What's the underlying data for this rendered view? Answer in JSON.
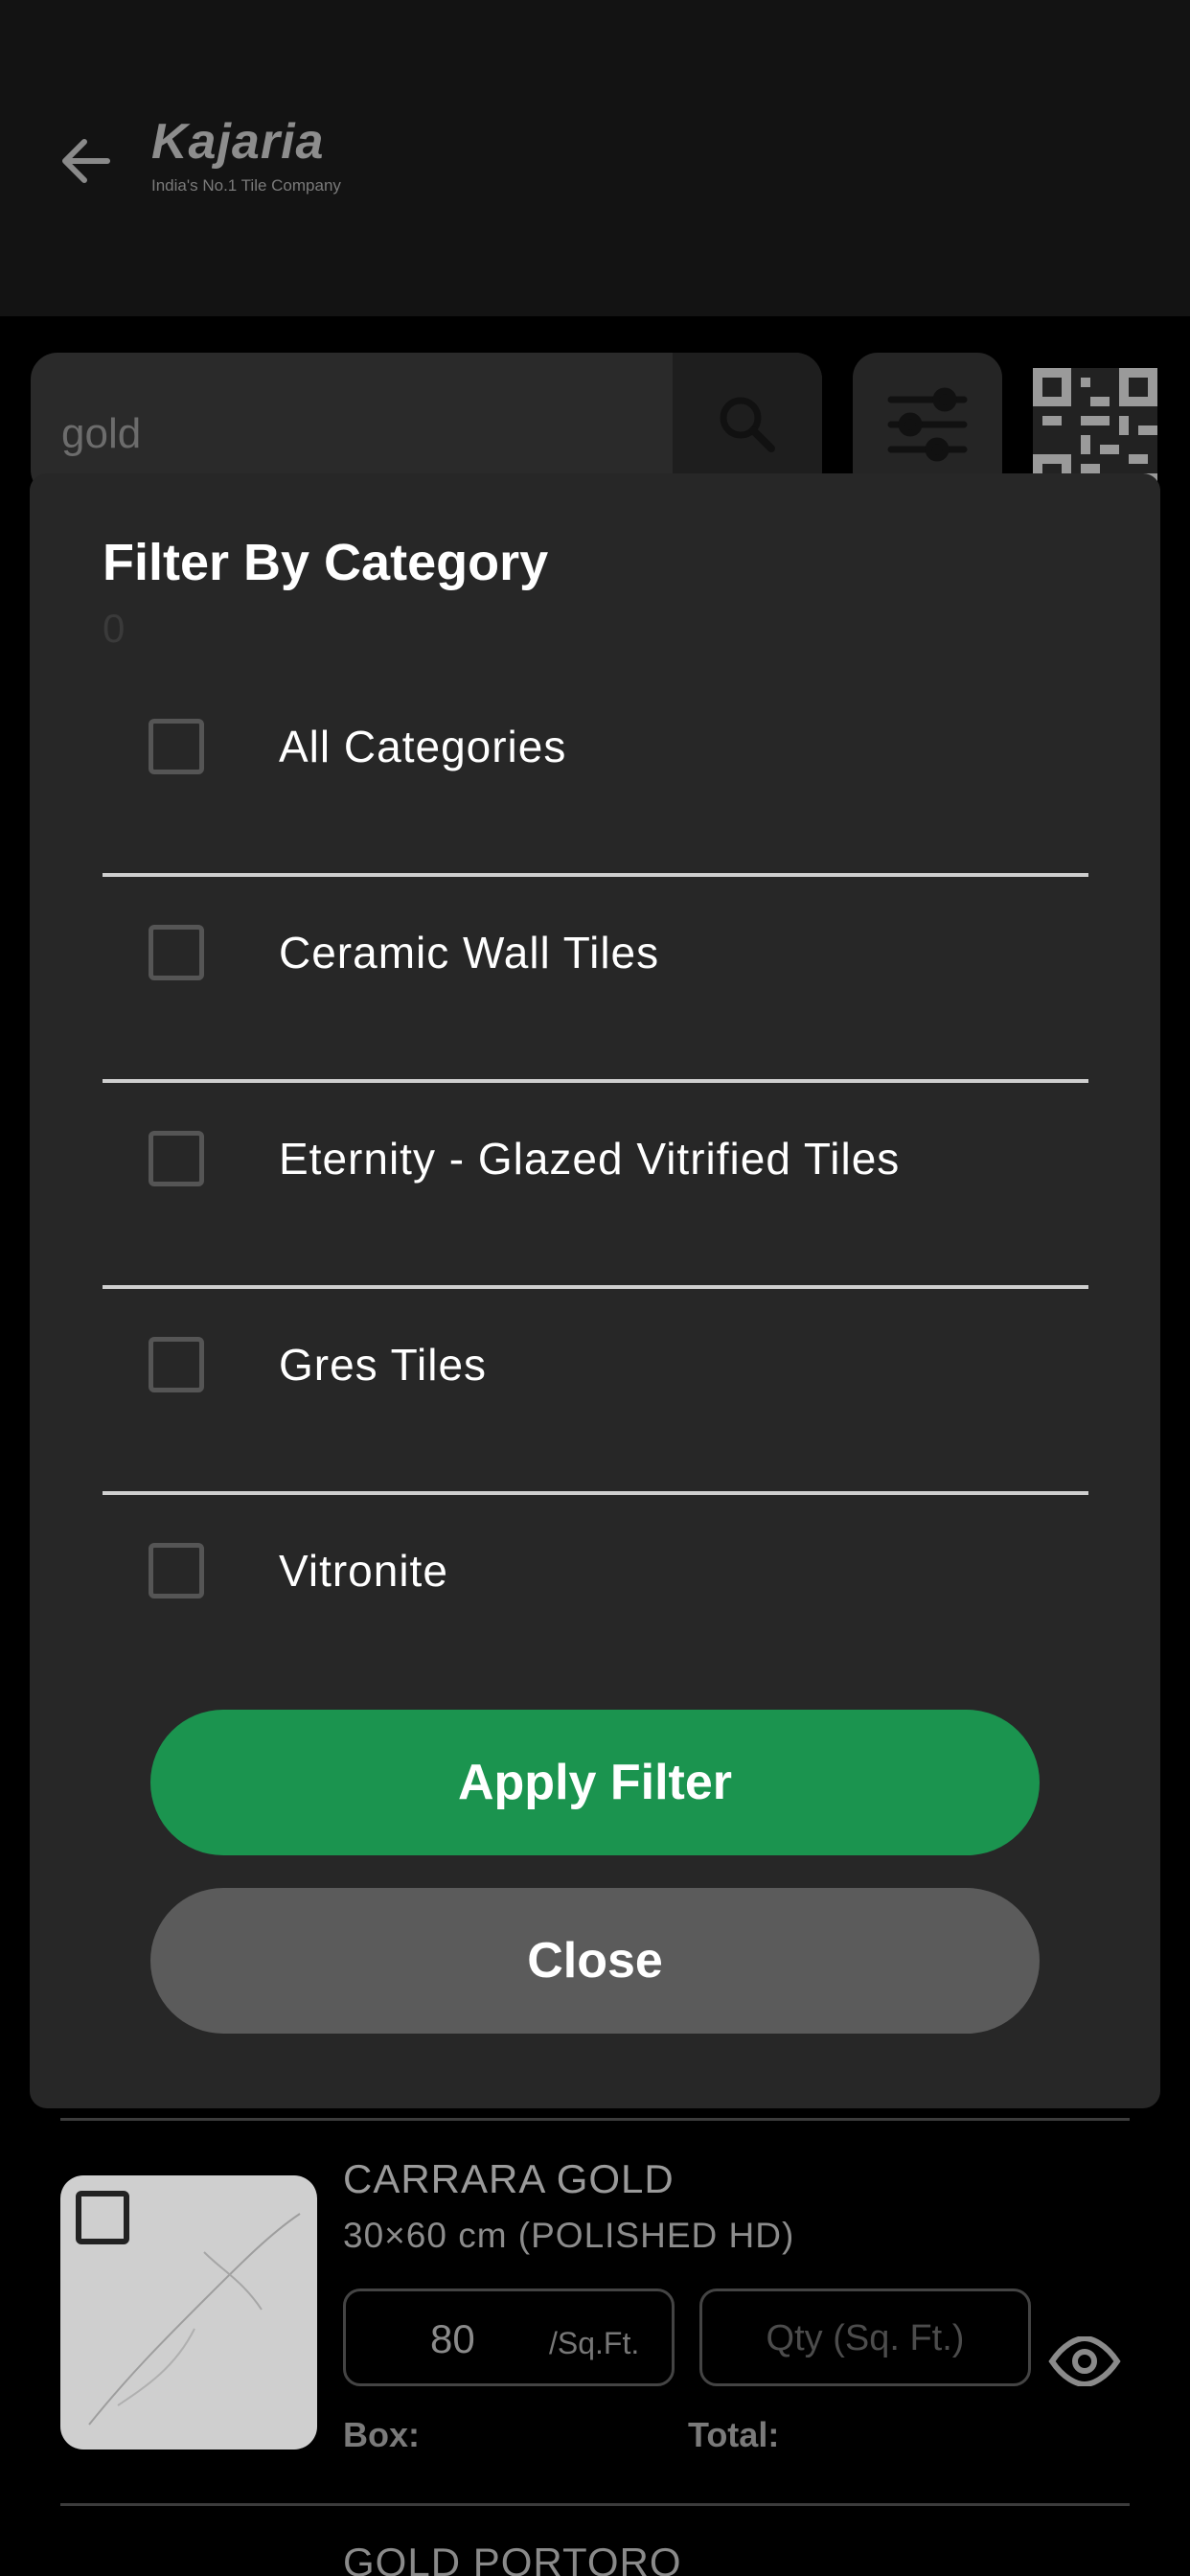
{
  "app": {
    "logo_name": "Kajaria",
    "logo_tagline": "India's No.1 Tile Company"
  },
  "search": {
    "value": "gold"
  },
  "modal": {
    "title": "Filter By Category",
    "count": "0",
    "categories": [
      {
        "label": "All Categories",
        "checked": false
      },
      {
        "label": "Ceramic Wall Tiles",
        "checked": false
      },
      {
        "label": "Eternity - Glazed Vitrified Tiles",
        "checked": false
      },
      {
        "label": "Gres Tiles",
        "checked": false
      },
      {
        "label": "Vitronite",
        "checked": false
      }
    ],
    "apply_label": "Apply Filter",
    "close_label": "Close"
  },
  "products": [
    {
      "name": "CARRARA GOLD",
      "size": "30×60 cm (POLISHED HD)",
      "price": "80",
      "price_unit": "/Sq.Ft.",
      "qty_placeholder": "Qty (Sq. Ft.)",
      "box_label": "Box:",
      "total_label": "Total:"
    },
    {
      "name": "GOLD PORTORO"
    }
  ],
  "colors": {
    "accent_green": "#1b944f",
    "close_gray": "#5b5b5b",
    "modal_bg": "#272727"
  }
}
